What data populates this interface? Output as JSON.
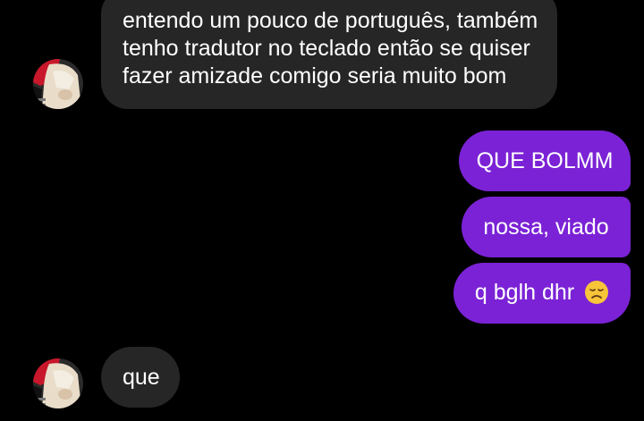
{
  "messages": [
    {
      "sender": "them",
      "lines": [
        "entendo um pouco de português, também",
        "tenho tradutor no teclado então se quiser",
        "fazer amizade comigo seria muito bom"
      ]
    },
    {
      "sender": "me",
      "text": "QUE BOLMM"
    },
    {
      "sender": "me",
      "text": "nossa, viado"
    },
    {
      "sender": "me",
      "text": "q bglh dhr",
      "emoji": "disappointed-face-emoji"
    },
    {
      "sender": "them",
      "text": "que"
    }
  ],
  "colors": {
    "background": "#000000",
    "incoming_bubble": "#262626",
    "outgoing_bubble": "#7b22d6",
    "text": "#ffffff"
  }
}
